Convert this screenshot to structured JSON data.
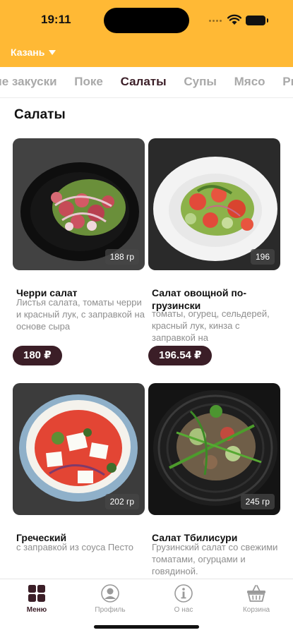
{
  "status": {
    "time": "19:11"
  },
  "header": {
    "city": "Казань"
  },
  "categories": [
    "ние закуски",
    "Поке",
    "Салаты",
    "Супы",
    "Мясо",
    "Рыба"
  ],
  "active_category": "Салаты",
  "section_title": "Салаты",
  "products": [
    {
      "name": "Черри салат",
      "weight": "188 гр",
      "description": "Листья салата, томаты черри и красный лук, с заправкой на основе сыра",
      "price": "180 ₽"
    },
    {
      "name": "Салат овощной по-грузински",
      "weight": "196",
      "description": "томаты, огурец, сельдерей, красный лук, кинза с заправкой на",
      "price": "196.54 ₽"
    },
    {
      "name": "Греческий",
      "weight": "202 гр",
      "description": "с заправкой из соуса Песто",
      "price": ""
    },
    {
      "name": "Салат Тбилисури",
      "weight": "245 гр",
      "description": "Грузинский салат со свежими томатами, огурцами и говядиной.",
      "price": ""
    }
  ],
  "tabbar": [
    {
      "label": "Меню",
      "icon": "menu-grid-icon",
      "active": true
    },
    {
      "label": "Профиль",
      "icon": "profile-icon",
      "active": false
    },
    {
      "label": "О нас",
      "icon": "info-icon",
      "active": false
    },
    {
      "label": "Корзина",
      "icon": "basket-icon",
      "active": false
    }
  ],
  "colors": {
    "accent": "#ffb935",
    "primary": "#3b1e27",
    "muted": "#a9a9a9"
  }
}
